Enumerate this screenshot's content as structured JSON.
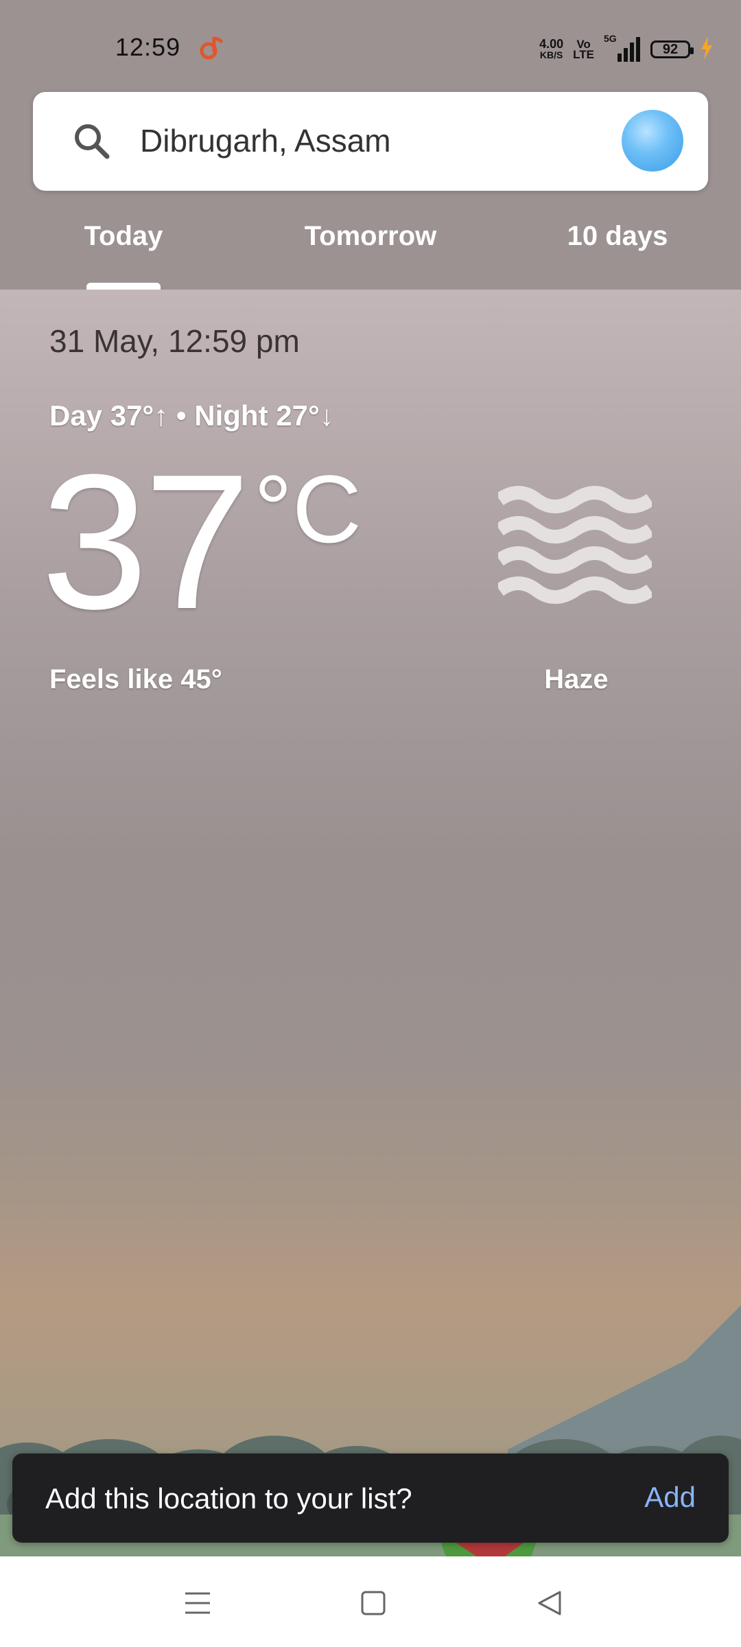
{
  "status_bar": {
    "time": "12:59",
    "net_speed_value": "4.00",
    "net_speed_unit": "KB/S",
    "volte_top": "Vo",
    "volte_bottom": "LTE",
    "network": "5G",
    "battery": "92",
    "app_icon": "music-note-icon",
    "colors": {
      "app_icon": "#e2552b",
      "charging": "#f5a623"
    }
  },
  "search": {
    "location": "Dibrugarh, Assam",
    "icon": "search-icon"
  },
  "tabs": [
    {
      "label": "Today",
      "selected": true
    },
    {
      "label": "Tomorrow",
      "selected": false
    },
    {
      "label": "10 days",
      "selected": false
    }
  ],
  "weather": {
    "datetime": "31 May, 12:59 pm",
    "day_night": "Day 37°↑ • Night 27°↓",
    "temperature": "37",
    "unit": "°C",
    "feels_like": "Feels like 45°",
    "condition": "Haze",
    "condition_icon": "haze-icon"
  },
  "snackbar": {
    "message": "Add this location to your list?",
    "action": "Add",
    "action_color": "#8ab4f8"
  },
  "nav_bar": {
    "buttons": [
      "menu-icon",
      "home-icon",
      "back-icon"
    ]
  }
}
